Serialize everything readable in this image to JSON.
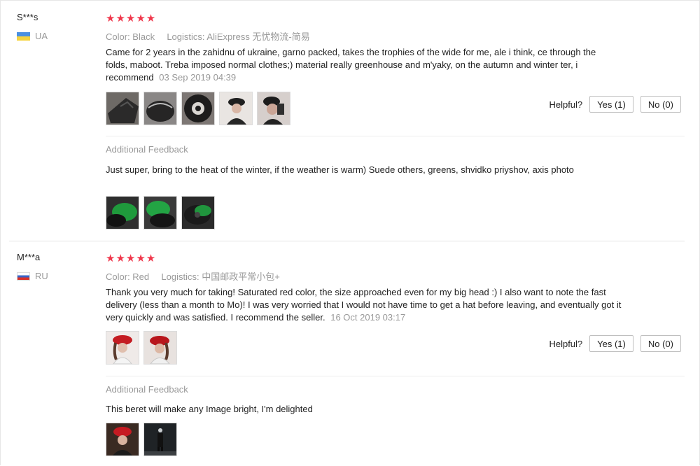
{
  "helpful_label": "Helpful?",
  "colors": {
    "star": "#f0384c",
    "muted": "#999999",
    "text": "#222222"
  },
  "reviews": [
    {
      "user": "S***s",
      "country": "UA",
      "stars": "★★★★★",
      "color_label": "Color: Black",
      "logistics_label": "Logistics: AliExpress 无忧物流-简易",
      "text": "Came for 2 years in the zahidnu of ukraine, garno packed, takes the trophies of the wide for me, ale i think, ce through the folds, maboot. Treba imposed normal clothes;) material really greenhouse and m'yaky, on the autumn and winter ter, i recommend",
      "date": "03 Sep 2019 04:39",
      "yes_label": "Yes (1)",
      "no_label": "No (0)",
      "feedback_title": "Additional Feedback",
      "feedback_text": "Just super, bring to the heat of the winter, if the weather is warm) Suede others, greens, shvidko priyshov, axis photo",
      "photos": [
        "black-beret-photo",
        "black-beret-photo",
        "black-beret-photo",
        "woman-in-beret-photo",
        "woman-in-beret-photo"
      ],
      "feedback_photos": [
        "green-beret-photo",
        "green-beret-photo",
        "green-beret-photo"
      ]
    },
    {
      "user": "M***a",
      "country": "RU",
      "stars": "★★★★★",
      "color_label": "Color: Red",
      "logistics_label": "Logistics: 中国邮政平常小包+",
      "text": "Thank you very much for taking! Saturated red color, the size approached even for my big head :) I also want to note the fast delivery (less than a month to Mo)! I was very worried that I would not have time to get a hat before leaving, and eventually got it very quickly and was satisfied. I recommend the seller.",
      "date": "16 Oct 2019 03:17",
      "yes_label": "Yes (1)",
      "no_label": "No (0)",
      "feedback_title": "Additional Feedback",
      "feedback_text": "This beret will make any Image bright, I'm delighted",
      "photos": [
        "red-beret-photo",
        "red-beret-photo"
      ],
      "feedback_photos": [
        "red-beret-photo",
        "night-street-photo"
      ]
    }
  ]
}
